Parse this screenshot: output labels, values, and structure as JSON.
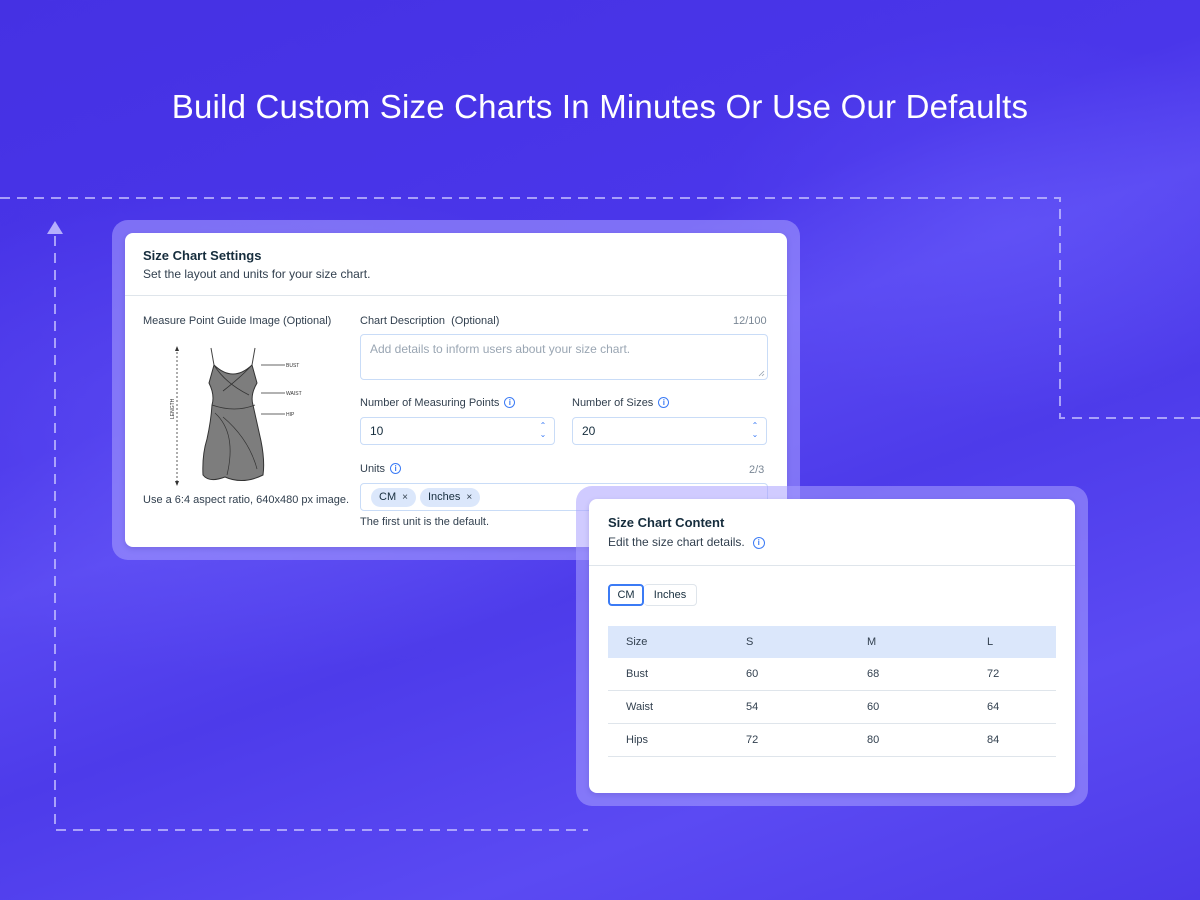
{
  "headline": "Build Custom Size Charts In Minutes Or Use Our Defaults",
  "settings": {
    "title": "Size Chart Settings",
    "subtitle": "Set the layout and units for your size chart.",
    "guide_image_label": "Measure Point Guide Image (Optional)",
    "guide_image_hint": "Use a 6:4 aspect ratio, 640x480 px image.",
    "diagram_labels": {
      "bust": "BUST",
      "waist": "WAIST",
      "hip": "HIP",
      "length": "LENGTH"
    },
    "description_label": "Chart Description  (Optional)",
    "description_counter": "12/100",
    "description_placeholder": "Add details to inform users about your size chart.",
    "measuring_points_label": "Number of Measuring Points",
    "measuring_points_value": "10",
    "sizes_label": "Number of Sizes",
    "sizes_value": "20",
    "units_label": "Units",
    "units_counter": "2/3",
    "units": [
      "CM",
      "Inches"
    ],
    "units_hint": "The first unit is the default."
  },
  "content": {
    "title": "Size Chart Content",
    "subtitle": "Edit the size chart details.",
    "unit_toggle": [
      "CM",
      "Inches"
    ],
    "selected_unit": "CM",
    "table": {
      "headers": [
        "Size",
        "S",
        "M",
        "L"
      ],
      "rows": [
        [
          "Bust",
          "60",
          "68",
          "72"
        ],
        [
          "Waist",
          "54",
          "60",
          "64"
        ],
        [
          "Hips",
          "72",
          "80",
          "84"
        ]
      ]
    }
  },
  "colors": {
    "background": "#4a36ea",
    "accent": "#3b7bf5",
    "tag_bg": "#dbe7fb"
  },
  "icons": {
    "info": "info-icon",
    "remove": "close-icon",
    "stepper": "chevron-up-down-icon"
  }
}
